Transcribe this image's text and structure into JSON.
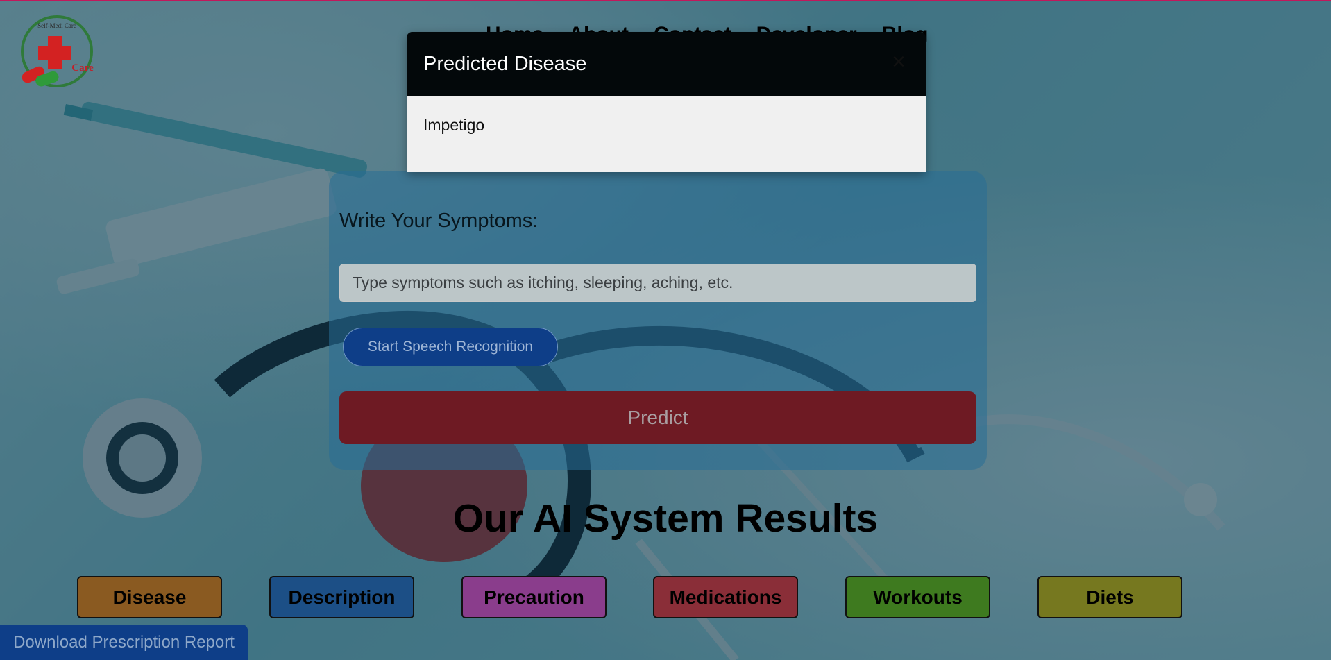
{
  "logo": {
    "top_text": "Self-Medi Care",
    "side_text": "Care"
  },
  "nav": {
    "items": [
      "Home",
      "About",
      "Contact",
      "Developer",
      "Blog"
    ]
  },
  "modal": {
    "title": "Predicted Disease",
    "close_icon": "close-icon",
    "result": "Impetigo"
  },
  "symptoms": {
    "label": "Write Your Symptoms:",
    "placeholder": "Type symptoms such as itching, sleeping, aching, etc.",
    "speech_button": "Start Speech Recognition",
    "predict_button": "Predict"
  },
  "results": {
    "heading": "Our AI System Results",
    "buttons": [
      {
        "label": "Disease",
        "color": "#8a5a21"
      },
      {
        "label": "Description",
        "color": "#1c4f86"
      },
      {
        "label": "Precaution",
        "color": "#8a3d8c"
      },
      {
        "label": "Medications",
        "color": "#8a2e38"
      },
      {
        "label": "Workouts",
        "color": "#3e7a1f"
      },
      {
        "label": "Diets",
        "color": "#76781f"
      }
    ]
  },
  "download": {
    "label": "Download Prescription Report"
  }
}
